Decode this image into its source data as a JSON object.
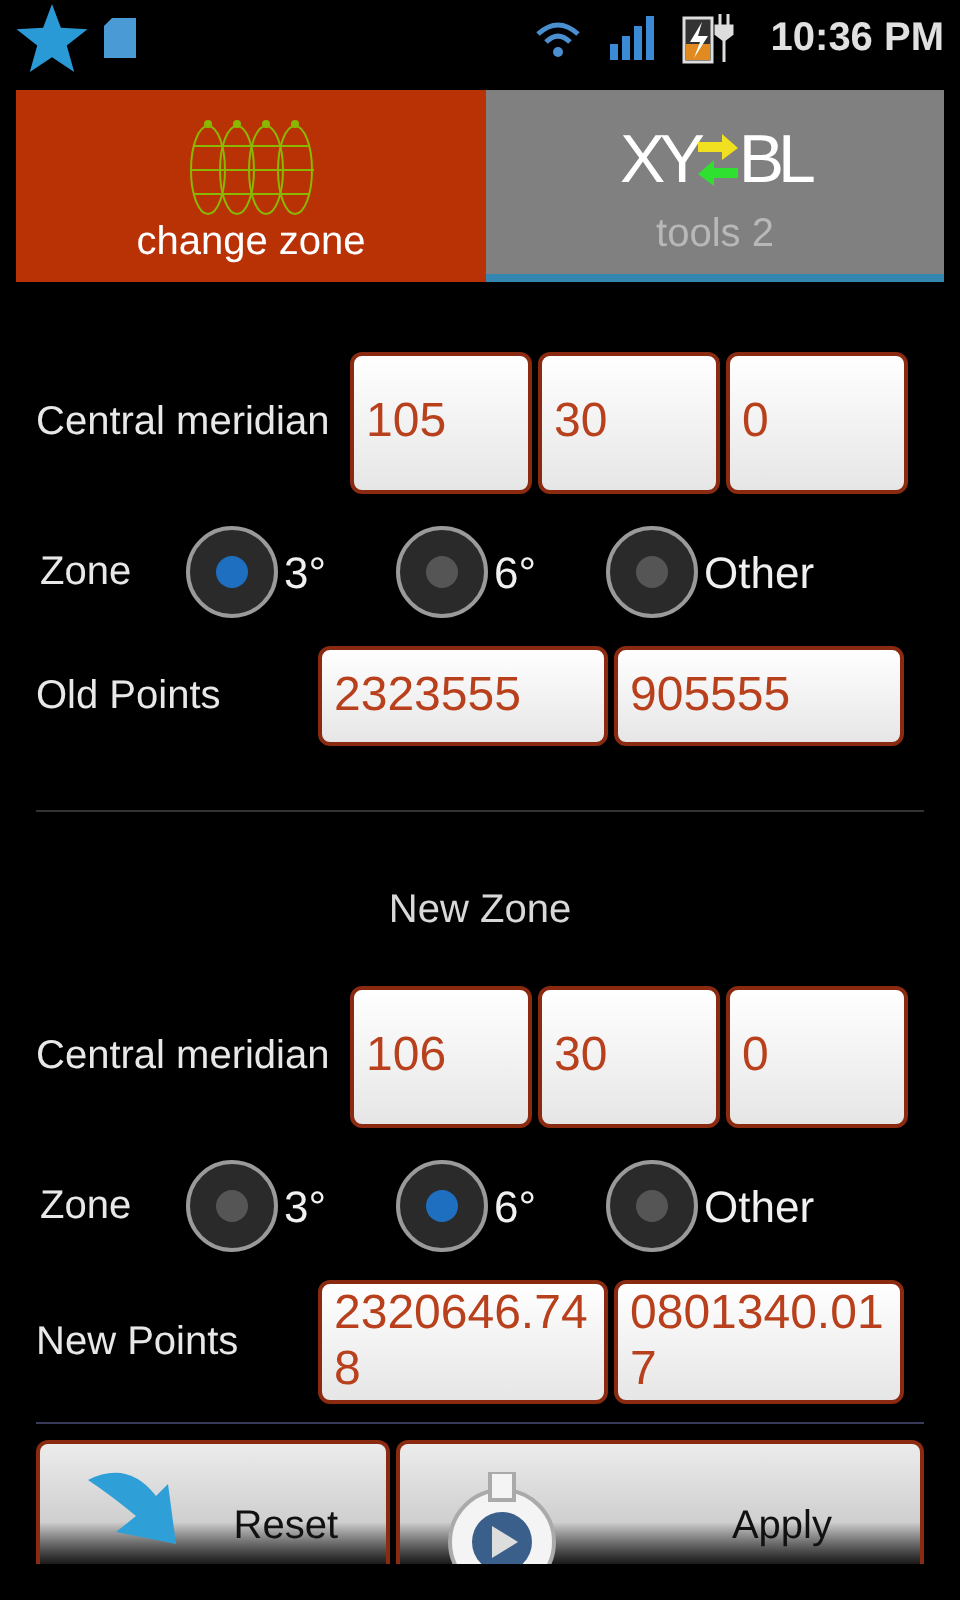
{
  "status_bar": {
    "time": "10:36 PM"
  },
  "tabs": [
    {
      "label": "change zone",
      "selected": true,
      "kind": "globe"
    },
    {
      "label": "tools 2",
      "selected": false,
      "kind": "logo",
      "logo_left": "XY",
      "logo_right": "BL"
    }
  ],
  "old_zone": {
    "meridian_label": "Central meridian",
    "meridian": [
      "105",
      "30",
      "0"
    ],
    "zone_label": "Zone",
    "zone_options": [
      {
        "label": "3°",
        "selected": true
      },
      {
        "label": "6°",
        "selected": false
      },
      {
        "label": "Other",
        "selected": false
      }
    ],
    "points_label": "Old Points",
    "points": [
      "2323555",
      "905555"
    ]
  },
  "new_zone": {
    "heading": "New Zone",
    "meridian_label": "Central meridian",
    "meridian": [
      "106",
      "30",
      "0"
    ],
    "zone_label": "Zone",
    "zone_options": [
      {
        "label": "3°",
        "selected": false
      },
      {
        "label": "6°",
        "selected": true
      },
      {
        "label": "Other",
        "selected": false
      }
    ],
    "points_label": "New Points",
    "points": [
      "2320646.748",
      "0801340.017"
    ]
  },
  "buttons": [
    {
      "label": "Reset",
      "kind": "reset"
    },
    {
      "label": "Apply",
      "kind": "apply"
    }
  ]
}
